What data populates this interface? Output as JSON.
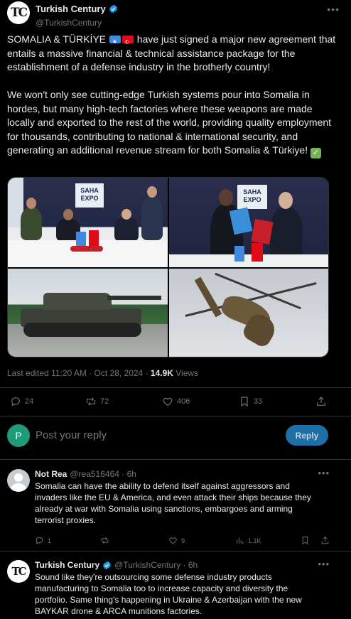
{
  "tweet": {
    "author": {
      "name": "Turkish Century",
      "handle": "@TurkishCentury",
      "avatar_icon": "turkish-century-logo",
      "avatar_text": "TC"
    },
    "text_intro": "SOMALIA & TÜRKİYE ",
    "text_after_flags": " have just signed a major new agreement that entails a massive financial & technical assistance package for the establishment of a defense industry in the brotherly country!",
    "text_body": "We won't only see cutting-edge Turkish systems pour into Somalia in hordes, but many high-tech factories where these weapons are made locally and exported to the rest of the world, providing quality employment for thousands, contributing to national & international security, and generating an additional revenue stream for both Somalia & Türkiye! ",
    "emoji_check_icon": "check-mark-emoji",
    "media": [
      {
        "name": "signing-ceremony-table-photo",
        "banner_text": "SAHA EXPO"
      },
      {
        "name": "agreement-handshake-photo",
        "banner_text": "SAHA EXPO"
      },
      {
        "name": "main-battle-tank-photo"
      },
      {
        "name": "attack-helicopter-photo"
      }
    ],
    "edited_label": "Last edited 11:20 AM · Oct 28, 2024 · ",
    "views_count": "14.9K",
    "views_label": " Views",
    "stats": {
      "replies": "24",
      "reposts": "72",
      "likes": "406",
      "bookmarks": "33"
    }
  },
  "composer": {
    "avatar_letter": "P",
    "placeholder": "Post your reply",
    "reply_label": "Reply"
  },
  "replies": [
    {
      "name": "Not Rea",
      "handle": "@rea516464 · 6h",
      "text": "Somalia can have the ability to defend itself against aggressors and invaders like the EU & America, and even attack their ships because they already at war with Somalia using sanctions, embargoes and arming terrorist proxies.",
      "stats": {
        "replies": "1",
        "likes": "9",
        "views": "1.1K"
      }
    },
    {
      "name": "Turkish Century",
      "handle": "@TurkishCentury · 6h",
      "text": "Sound like they're outsourcing some defense industry products manufacturing to Somalia too to increase capacity and diversity the portfolio. Same thing's happening in Ukraine & Azerbaijan with the new BAYKAR drone & ARCA munitions factories."
    }
  ],
  "colors": {
    "background": "#000000",
    "text": "#e7e9ea",
    "muted": "#71767b",
    "accent": "#1d9bf0",
    "divider": "#2f3336"
  }
}
